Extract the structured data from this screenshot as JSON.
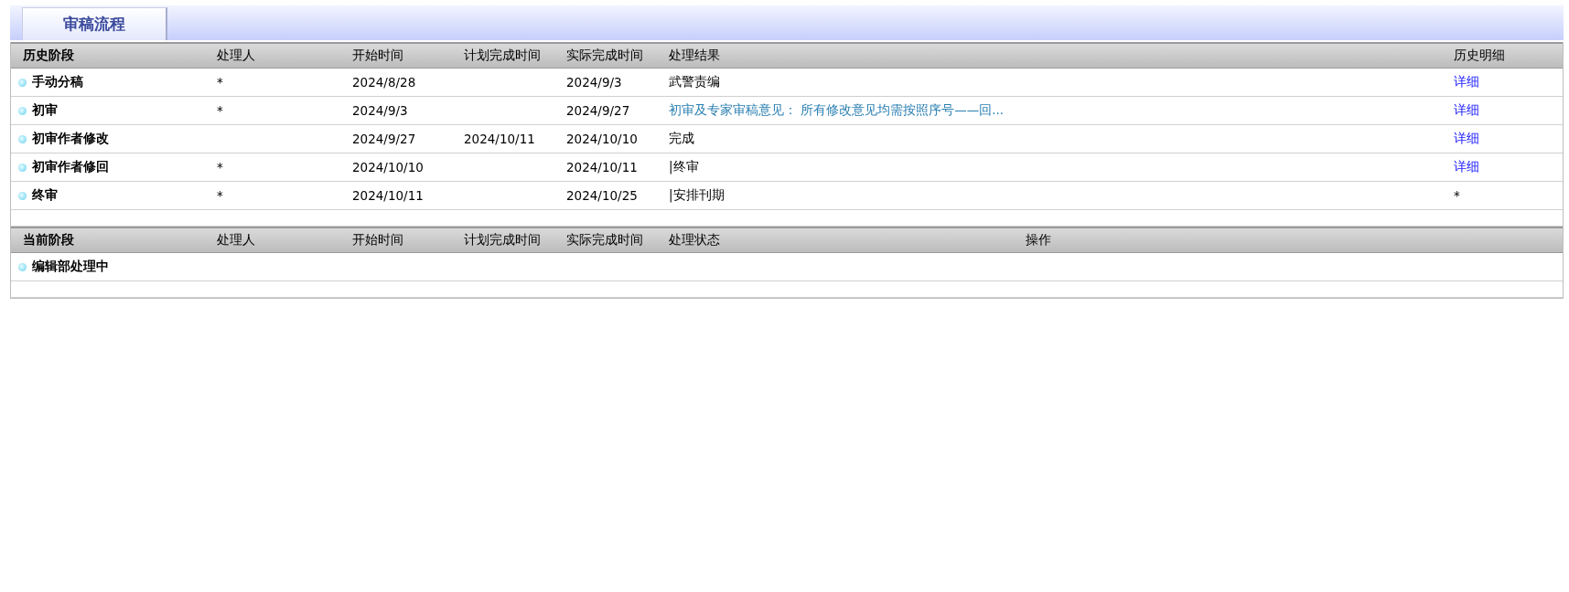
{
  "tab": {
    "label": "审稿流程",
    "selected": true
  },
  "history": {
    "columns": [
      "历史阶段",
      "处理人",
      "开始时间",
      "计划完成时间",
      "实际完成时间",
      "处理结果",
      "历史明细"
    ],
    "rows": [
      {
        "stage": "手动分稿",
        "handler": "*",
        "start": "2024/8/28",
        "actual_finish": "2024/9/3",
        "result": {
          "text": "武警责编",
          "kind": "text"
        },
        "detail": {
          "text": "详细",
          "kind": "link"
        }
      },
      {
        "stage": "初审",
        "handler": "*",
        "start": "2024/9/3",
        "actual_finish": "2024/9/27",
        "result": {
          "text": "初审及专家审稿意见：  所有修改意见均需按照序号——回...",
          "kind": "link"
        },
        "detail": {
          "text": "详细",
          "kind": "link"
        }
      },
      {
        "stage": "初审作者修改",
        "start": "2024/9/27",
        "planned_finish": "2024/10/11",
        "actual_finish": "2024/10/10",
        "result": {
          "text": "完成",
          "kind": "text"
        },
        "detail": {
          "text": "详细",
          "kind": "link"
        }
      },
      {
        "stage": "初审作者修回",
        "handler": "*",
        "start": "2024/10/10",
        "actual_finish": "2024/10/11",
        "result": {
          "text": "|终审",
          "kind": "text"
        },
        "detail": {
          "text": "详细",
          "kind": "link"
        }
      },
      {
        "stage": "终审",
        "handler": "*",
        "start": "2024/10/11",
        "actual_finish": "2024/10/25",
        "result": {
          "text": "|安排刊期",
          "kind": "text"
        },
        "detail": {
          "text": "*",
          "kind": "text"
        }
      }
    ]
  },
  "current": {
    "columns": [
      "当前阶段",
      "处理人",
      "开始时间",
      "计划完成时间",
      "实际完成时间",
      "处理状态",
      "操作"
    ],
    "rows": [
      {
        "stage": "编辑部处理中"
      }
    ]
  }
}
